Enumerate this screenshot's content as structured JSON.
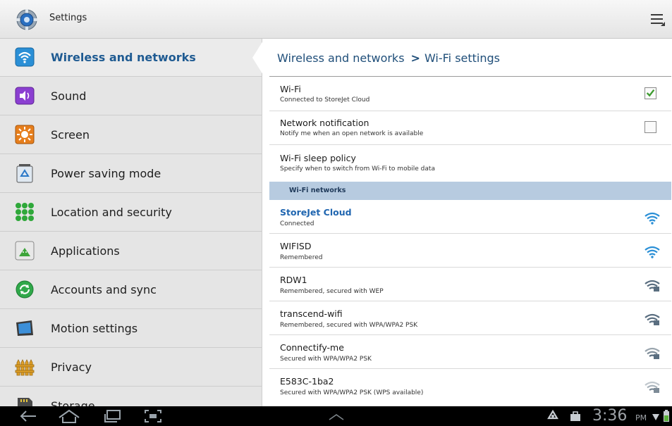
{
  "app": {
    "title": "Settings"
  },
  "sidebar": {
    "items": [
      {
        "label": "Wireless and networks",
        "icon": "wifi-icon",
        "selected": true
      },
      {
        "label": "Sound",
        "icon": "speaker-icon"
      },
      {
        "label": "Screen",
        "icon": "brightness-icon"
      },
      {
        "label": "Power saving mode",
        "icon": "recycle-battery-icon"
      },
      {
        "label": "Location and security",
        "icon": "location-grid-icon"
      },
      {
        "label": "Applications",
        "icon": "android-app-icon"
      },
      {
        "label": "Accounts and sync",
        "icon": "sync-icon"
      },
      {
        "label": "Motion settings",
        "icon": "motion-tablet-icon"
      },
      {
        "label": "Privacy",
        "icon": "fence-icon"
      },
      {
        "label": "Storage",
        "icon": "sd-card-icon"
      }
    ]
  },
  "main": {
    "breadcrumb": {
      "parent": "Wireless and networks",
      "separator": ">",
      "current": "Wi-Fi settings"
    },
    "settings": [
      {
        "title": "Wi-Fi",
        "subtitle": "Connected to StoreJet Cloud",
        "checked": true
      },
      {
        "title": "Network notification",
        "subtitle": "Notify me when an open network is available",
        "checked": false
      },
      {
        "title": "Wi-Fi sleep policy",
        "subtitle": "Specify when to switch from Wi-Fi to mobile data"
      }
    ],
    "section_header": "Wi-Fi networks",
    "networks": [
      {
        "name": "StoreJet Cloud",
        "status": "Connected",
        "secured": false,
        "connected": true
      },
      {
        "name": "WIFISD",
        "status": "Remembered",
        "secured": false
      },
      {
        "name": "RDW1",
        "status": "Remembered, secured with WEP",
        "secured": true
      },
      {
        "name": "transcend-wifi",
        "status": "Remembered, secured with WPA/WPA2 PSK",
        "secured": true
      },
      {
        "name": "Connectify-me",
        "status": "Secured with WPA/WPA2 PSK",
        "secured": true
      },
      {
        "name": "E583C-1ba2",
        "status": "Secured with WPA/WPA2 PSK (WPS available)",
        "secured": true
      }
    ]
  },
  "statusbar": {
    "time": "3:36",
    "ampm": "PM"
  },
  "colors": {
    "accent": "#1f5b92",
    "link": "#2066b0",
    "section_bg": "#b7cbe0",
    "check": "#3c9b2e",
    "navbar": "#000000"
  }
}
